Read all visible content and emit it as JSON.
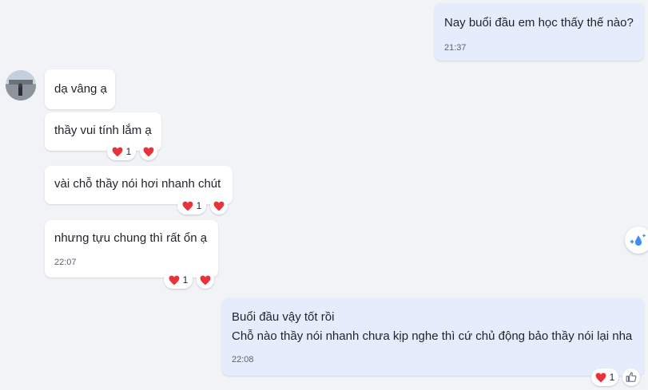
{
  "colors": {
    "background": "#f1f3f6",
    "incoming_bubble": "#ffffff",
    "outgoing_bubble": "#e5ecfc",
    "heart": "#e8323c",
    "accent": "#3d8df5"
  },
  "icons": {
    "heart": "heart-icon",
    "like": "thumbs-up-icon",
    "quick_reaction": "sparkle-drop-icon"
  },
  "messages": [
    {
      "side": "out",
      "text": "Nay buổi đầu em học thấy thế nào?",
      "time": "21:37"
    },
    {
      "side": "in",
      "text": "dạ vâng ạ"
    },
    {
      "side": "in",
      "text": "thầy vui tính lắm ạ",
      "reaction_count": "1"
    },
    {
      "side": "in",
      "text": "vài chỗ thầy nói hơi nhanh chút",
      "reaction_count": "1"
    },
    {
      "side": "in",
      "text": "nhưng tựu chung thì rất ổn ạ",
      "time": "22:07",
      "reaction_count": "1"
    },
    {
      "side": "out",
      "lines": [
        "Buổi đầu vậy tốt rồi",
        "Chỗ nào thầy nói nhanh chưa kịp nghe thì cứ chủ động bảo thầy nói lại nha"
      ],
      "time": "22:08",
      "reaction_count": "1"
    }
  ]
}
